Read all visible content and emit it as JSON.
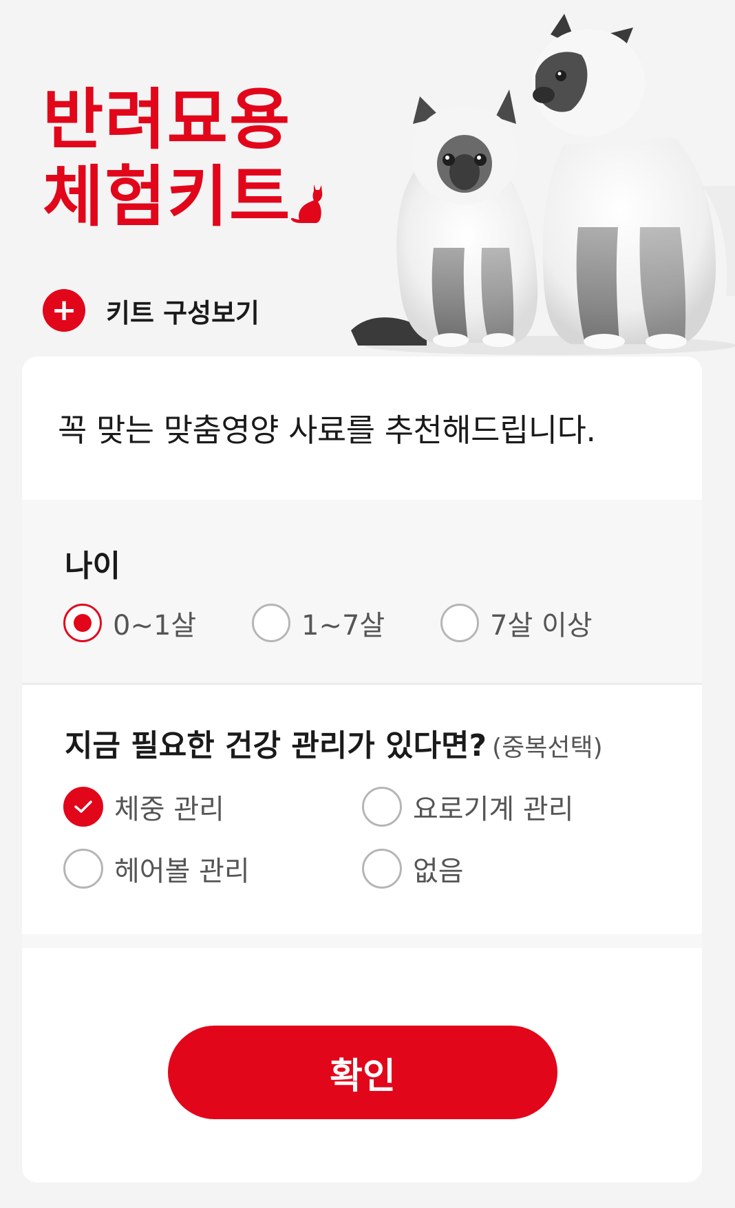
{
  "hero": {
    "title_line1": "반려묘용",
    "title_line2": "체험키트",
    "kit_link_label": "키트 구성보기",
    "plus_icon": "+"
  },
  "card": {
    "intro": "꼭 맞는 맞춤영양 사료를 추천해드립니다."
  },
  "age": {
    "title": "나이",
    "options": [
      {
        "label": "0~1살",
        "selected": true
      },
      {
        "label": "1~7살",
        "selected": false
      },
      {
        "label": "7살 이상",
        "selected": false
      }
    ]
  },
  "health": {
    "title": "지금 필요한 건강 관리가 있다면?",
    "note": "(중복선택)",
    "options": [
      {
        "label": "체중 관리",
        "selected": true
      },
      {
        "label": "요로기계 관리",
        "selected": false
      },
      {
        "label": "헤어볼 관리",
        "selected": false
      },
      {
        "label": "없음",
        "selected": false
      }
    ]
  },
  "confirm_label": "확인",
  "colors": {
    "accent": "#e2061b",
    "background": "#f4f4f4",
    "card": "#ffffff",
    "section_bg": "#f7f7f7"
  }
}
